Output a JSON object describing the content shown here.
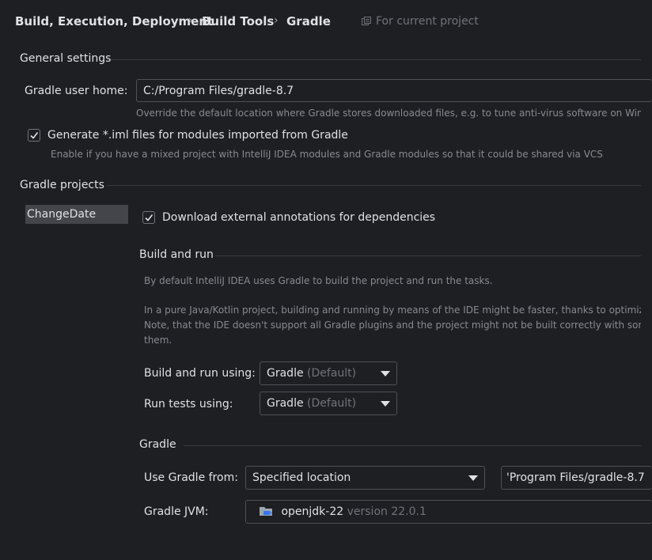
{
  "breadcrumb": {
    "items": [
      "Build, Execution, Deployment",
      "Build Tools",
      "Gradle"
    ],
    "separator": "›",
    "scope_label": "For current project"
  },
  "general": {
    "title": "General settings",
    "user_home_label": "Gradle user home:",
    "user_home_value": "C:/Program Files/gradle-8.7",
    "user_home_hint": "Override the default location where Gradle stores downloaded files, e.g. to tune anti-virus software on Window",
    "generate_iml_label": "Generate *.iml files for modules imported from Gradle",
    "generate_iml_checked": true,
    "generate_iml_hint": "Enable if you have a mixed project with IntelliJ IDEA modules and Gradle modules so that it could be shared via VCS"
  },
  "projects": {
    "title": "Gradle projects",
    "list": [
      "ChangeDate"
    ],
    "download_annotations_label": "Download external annotations for dependencies",
    "download_annotations_checked": true
  },
  "build_run": {
    "title": "Build and run",
    "desc1": "By default IntelliJ IDEA uses Gradle to build the project and run the tasks.",
    "desc2_line1": "In a pure Java/Kotlin project, building and running by means of the IDE might be faster, thanks to optimizatio",
    "desc2_line2": "Note, that the IDE doesn't support all Gradle plugins and the project might not be built correctly with some",
    "desc2_line3": "them.",
    "build_using_label": "Build and run using:",
    "build_using_value": "Gradle",
    "build_using_suffix": "(Default)",
    "tests_using_label": "Run tests using:",
    "tests_using_value": "Gradle",
    "tests_using_suffix": "(Default)"
  },
  "gradle": {
    "title": "Gradle",
    "use_from_label": "Use Gradle from:",
    "use_from_value": "Specified location",
    "location_value": "'Program Files/gradle-8.7",
    "jvm_label": "Gradle JVM:",
    "jvm_name": "openjdk-22",
    "jvm_version": "version 22.0.1"
  },
  "colors": {
    "background": "#1e1f22",
    "text": "#dfe1e5",
    "hint": "#868a91",
    "border": "#4e5157",
    "selection": "#43454a"
  }
}
